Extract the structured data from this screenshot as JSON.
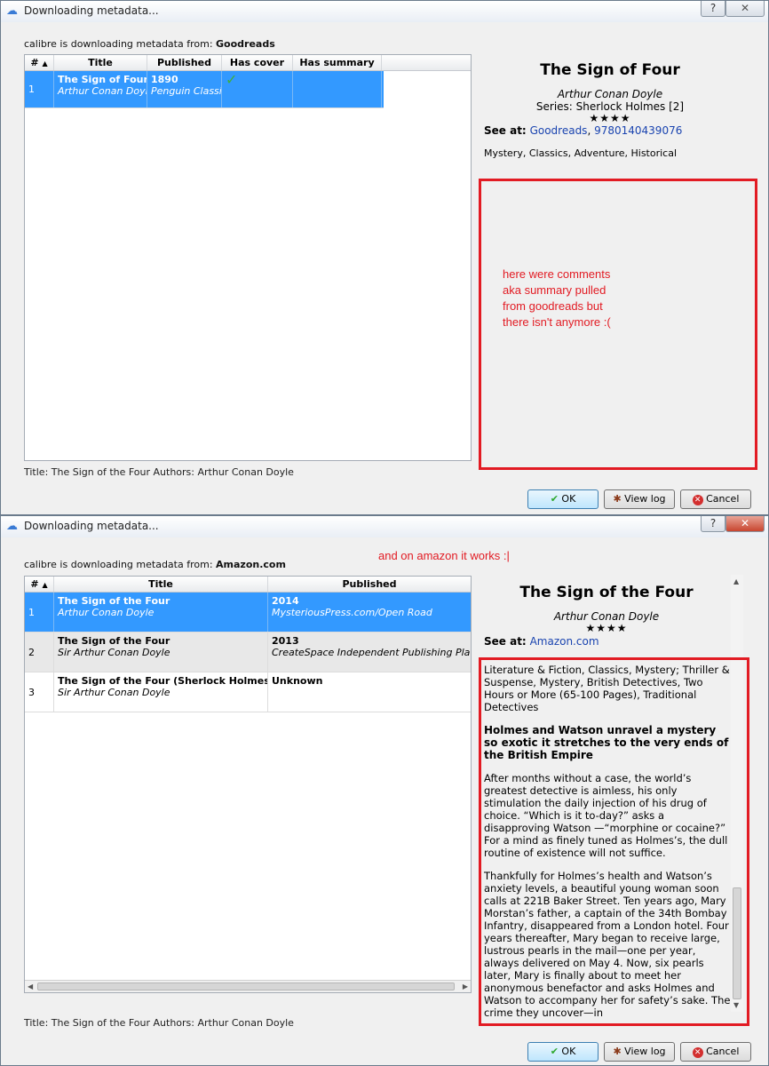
{
  "window1": {
    "title": "Downloading metadata...",
    "help": "?",
    "close": "✕",
    "source_prefix": "calibre is downloading metadata from:",
    "source": "Goodreads",
    "headers": [
      "#",
      "Title",
      "Published",
      "Has cover",
      "Has summary"
    ],
    "rows": [
      {
        "num": "1",
        "title": "The Sign of Four",
        "author": "Arthur Conan Doyle",
        "year": "1890",
        "publisher": "Penguin Classics",
        "has_cover": true
      }
    ],
    "status": "Title: The Sign of the Four Authors: Arthur Conan Doyle",
    "details": {
      "title": "The Sign of Four",
      "author": "Arthur Conan Doyle",
      "series": "Series: Sherlock Holmes [2]",
      "stars": "★★★★",
      "see_at_label": "See at:",
      "link1": "Goodreads",
      "sep": ",",
      "link2": "9780140439076",
      "tags": "Mystery, Classics, Adventure, Historical"
    },
    "annotation": [
      "here were comments",
      "aka summary pulled",
      "from goodreads but",
      "there isn't anymore  :("
    ],
    "buttons": {
      "ok": "OK",
      "log": "View log",
      "cancel": "Cancel"
    }
  },
  "window2": {
    "title": "Downloading metadata...",
    "help": "?",
    "close": "✕",
    "source_prefix": "calibre is downloading metadata from:",
    "source": "Amazon.com",
    "annotation": "and on amazon it  works  :|",
    "headers": [
      "#",
      "Title",
      "Published"
    ],
    "rows": [
      {
        "num": "1",
        "title": "The Sign of the Four",
        "author": "Arthur Conan Doyle",
        "year": "2014",
        "publisher": "MysteriousPress.com/Open Road"
      },
      {
        "num": "2",
        "title": "The Sign of the Four",
        "author": "Sir Arthur Conan Doyle",
        "year": "2013",
        "publisher": "CreateSpace Independent Publishing Platform"
      },
      {
        "num": "3",
        "title": "The Sign of the Four (Sherlock Holmes Boo",
        "author": "Sir Arthur Conan Doyle",
        "year": "Unknown",
        "publisher": ""
      }
    ],
    "status": "Title: The Sign of the Four Authors: Arthur Conan Doyle",
    "details": {
      "title": "The Sign of the Four",
      "author": "Arthur Conan Doyle",
      "stars": "★★★★",
      "see_at_label": "See at:",
      "link1": "Amazon.com",
      "tags": "Literature & Fiction, Classics, Mystery; Thriller & Suspense, Mystery, British Detectives, Two Hours or More (65-100 Pages), Traditional Detectives",
      "headline": "Holmes and Watson unravel a mystery so exotic it stretches to the very ends of the British Empire",
      "para1": "After months without a case, the world’s greatest detective is aimless, his only stimulation the daily injection of his drug of choice. “Which is it to-day?” asks a disapproving Watson —“morphine or cocaine?” For a mind as finely tuned as Holmes’s, the dull routine of existence will not suffice.",
      "para2": "Thankfully for Holmes’s health and Watson’s anxiety levels, a beautiful young woman soon calls at 221B Baker Street. Ten years ago, Mary Morstan’s father, a captain of the 34th Bombay Infantry, disappeared from a London hotel. Four years thereafter, Mary began to receive large, lustrous pearls in the mail—one per year, always delivered on May 4. Now, six pearls later, Mary is finally about to meet her anonymous benefactor and asks Holmes and Watson to accompany her for safety’s sake. The crime they uncover—in"
    },
    "buttons": {
      "ok": "OK",
      "log": "View log",
      "cancel": "Cancel"
    }
  }
}
